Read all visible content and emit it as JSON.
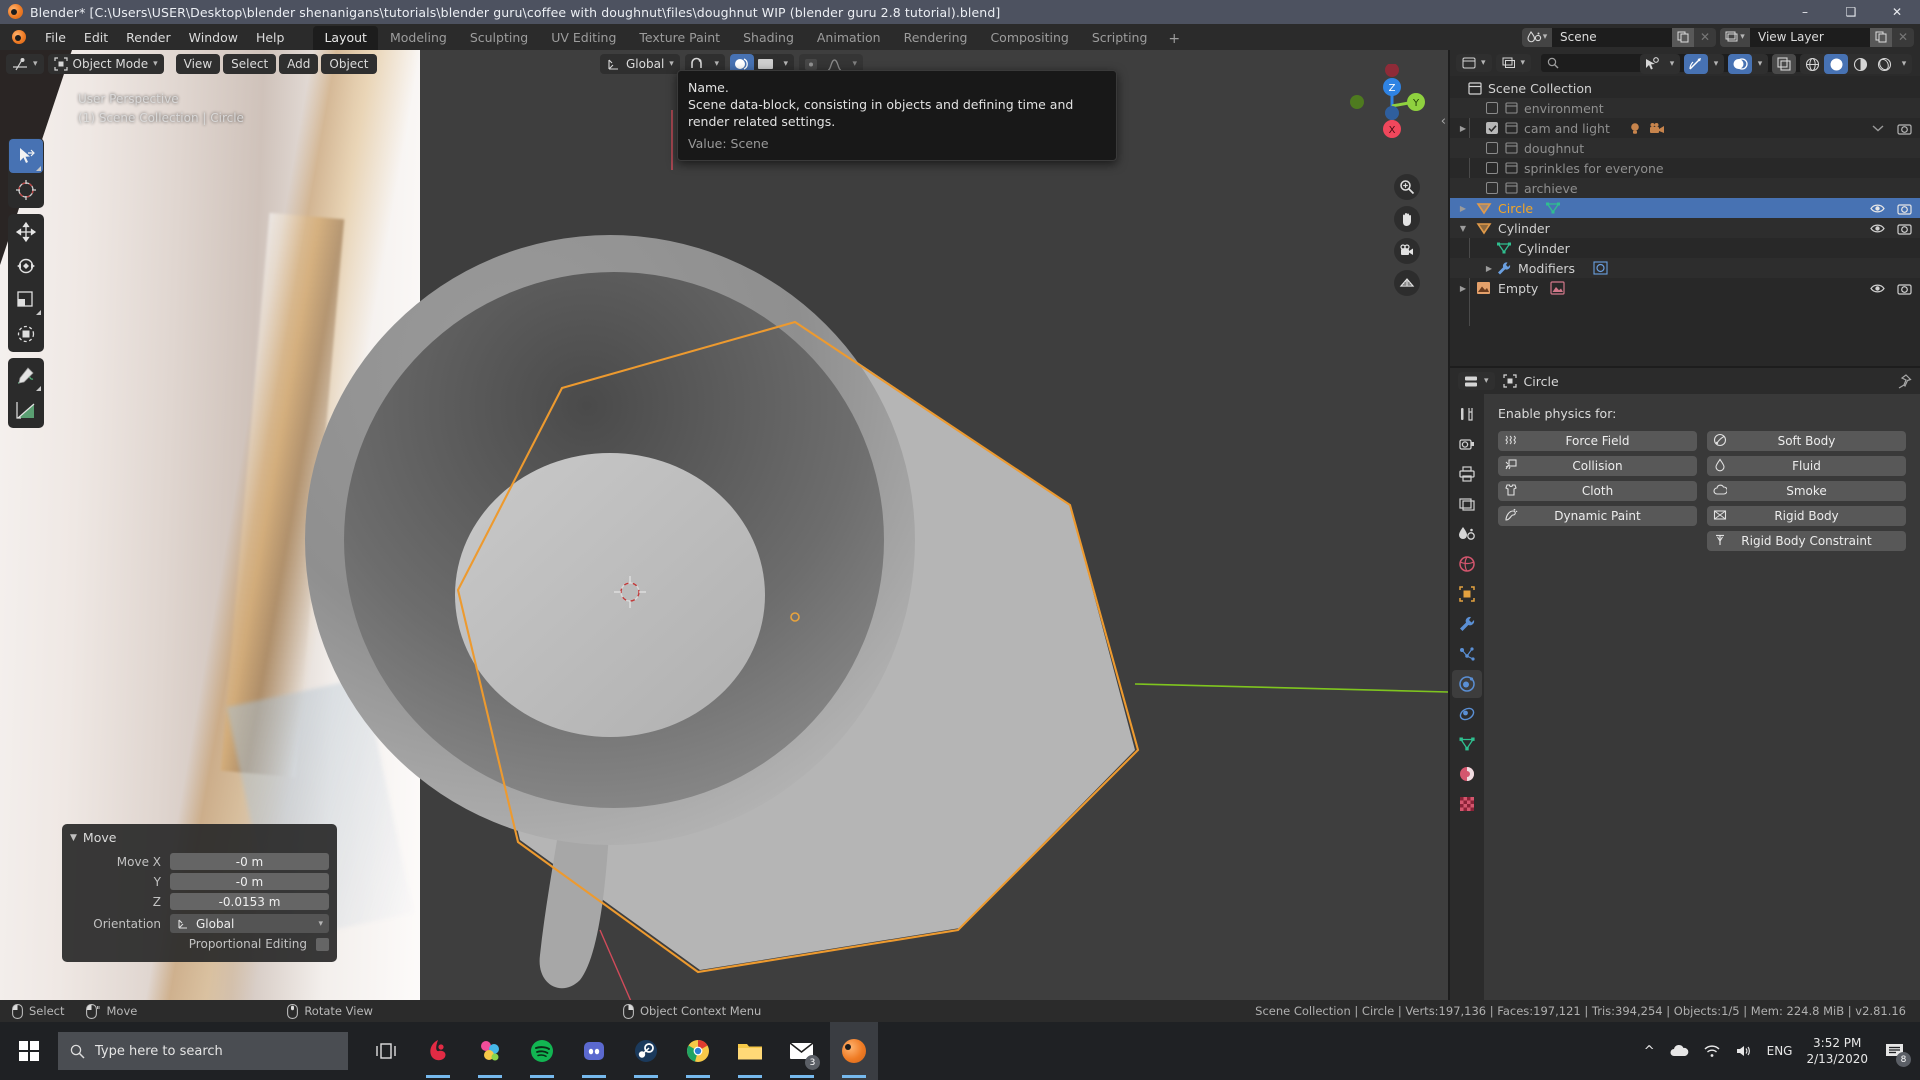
{
  "window": {
    "title": "Blender* [C:\\Users\\USER\\Desktop\\blender shenanigans\\tutorials\\blender guru\\coffee with doughnut\\files\\doughnut WIP (blender guru 2.8 tutorial).blend]",
    "minimize": "–",
    "maximize": "❑",
    "close": "✕"
  },
  "topbar": {
    "menus": [
      "File",
      "Edit",
      "Render",
      "Window",
      "Help"
    ],
    "workspaces": [
      "Layout",
      "Modeling",
      "Sculpting",
      "UV Editing",
      "Texture Paint",
      "Shading",
      "Animation",
      "Rendering",
      "Compositing",
      "Scripting"
    ],
    "active_workspace": "Layout",
    "add_workspace": "+",
    "scene_datablock": "Scene",
    "viewlayer_datablock": "View Layer"
  },
  "viewport": {
    "editor_mode": "Object Mode",
    "menus": [
      "View",
      "Select",
      "Add",
      "Object"
    ],
    "transform_orientation": "Global",
    "overlay_line1": "User Perspective",
    "overlay_line2": "(1) Scene Collection | Circle",
    "gizmo_axes": {
      "x": "X",
      "y": "Y",
      "z": "Z"
    }
  },
  "tooltip": {
    "line1": "Name.",
    "line2": "Scene data-block, consisting in objects and defining time and render related settings.",
    "value": "Value: Scene"
  },
  "operator_panel": {
    "title": "Move",
    "collapse_icon": "▼",
    "rows": [
      {
        "label": "Move X",
        "value": "-0 m"
      },
      {
        "label": "Y",
        "value": "-0 m"
      },
      {
        "label": "Z",
        "value": "-0.0153 m"
      }
    ],
    "orientation_label": "Orientation",
    "orientation_value": "Global",
    "proportional_label": "Proportional Editing"
  },
  "outliner": {
    "root": "Scene Collection",
    "items": [
      {
        "label": "environment",
        "type": "collection",
        "checked": false,
        "dim": true,
        "indent": 1,
        "expandable": false,
        "eye": false,
        "cam": false
      },
      {
        "label": "cam and light",
        "type": "collection",
        "checked": true,
        "dim": true,
        "indent": 1,
        "expandable": true,
        "eye": false,
        "cam": true,
        "extra_icons": [
          "light-icon",
          "camera-icon"
        ],
        "chevron": true
      },
      {
        "label": "doughnut",
        "type": "collection",
        "checked": false,
        "dim": true,
        "indent": 1,
        "expandable": false,
        "eye": false,
        "cam": false
      },
      {
        "label": "sprinkles for everyone",
        "type": "collection",
        "checked": false,
        "dim": true,
        "indent": 1,
        "expandable": false,
        "eye": false,
        "cam": false
      },
      {
        "label": "archieve",
        "type": "collection",
        "checked": false,
        "dim": true,
        "indent": 1,
        "expandable": false,
        "eye": false,
        "cam": false
      },
      {
        "label": "Circle",
        "type": "mesh-object",
        "selected": true,
        "indent": 1,
        "expandable": true,
        "eye": true,
        "cam": true,
        "extra_icons": [
          "mesh-data-icon"
        ]
      },
      {
        "label": "Cylinder",
        "type": "mesh-object",
        "indent": 1,
        "expandable": true,
        "expanded": true,
        "eye": true,
        "cam": true
      },
      {
        "label": "Cylinder",
        "type": "mesh-data",
        "indent": 2,
        "expandable": false,
        "eye": false,
        "cam": false
      },
      {
        "label": "Modifiers",
        "type": "modifier",
        "indent": 2,
        "expandable": true,
        "eye": false,
        "cam": false,
        "extra_icons": [
          "subsurf-icon"
        ]
      },
      {
        "label": "Empty",
        "type": "empty-image",
        "indent": 1,
        "expandable": true,
        "eye": true,
        "cam": true,
        "extra_icons": [
          "image-icon"
        ]
      }
    ]
  },
  "properties": {
    "breadcrumb_object": "Circle",
    "heading": "Enable physics for:",
    "physics_buttons_left": [
      {
        "label": "Force Field",
        "icon": "force-field-icon"
      },
      {
        "label": "Collision",
        "icon": "collision-icon"
      },
      {
        "label": "Cloth",
        "icon": "cloth-icon"
      },
      {
        "label": "Dynamic Paint",
        "icon": "dynamic-paint-icon"
      }
    ],
    "physics_buttons_right": [
      {
        "label": "Soft Body",
        "icon": "soft-body-icon"
      },
      {
        "label": "Fluid",
        "icon": "fluid-icon"
      },
      {
        "label": "Smoke",
        "icon": "smoke-icon"
      },
      {
        "label": "Rigid Body",
        "icon": "rigid-body-icon"
      },
      {
        "label": "Rigid Body Constraint",
        "icon": "rigid-body-constraint-icon"
      }
    ],
    "tabs": [
      "tool-tab",
      "render-tab",
      "output-tab",
      "view-layer-tab",
      "scene-tab",
      "world-tab",
      "object-tab",
      "modifier-tab",
      "particles-tab",
      "physics-tab",
      "constraints-tab",
      "data-tab",
      "material-tab",
      "texture-tab"
    ],
    "active_tab": "physics-tab"
  },
  "statusbar": {
    "keymap": [
      {
        "label": "Select",
        "icon": "mouse-left-icon"
      },
      {
        "label": "Move",
        "icon": "mouse-move-icon"
      },
      {
        "label": "Rotate View",
        "icon": "mouse-middle-icon"
      },
      {
        "label": "Object Context Menu",
        "icon": "mouse-right-icon"
      }
    ],
    "stats": "Scene Collection | Circle | Verts:197,136 | Faces:197,121 | Tris:394,254 | Objects:1/5 | Mem: 224.8 MiB | v2.81.16"
  },
  "taskbar": {
    "search_placeholder": "Type here to search",
    "apps": [
      "task-view-icon",
      "krita-icon",
      "paint3d-icon",
      "spotify-icon",
      "discord-icon",
      "steam-icon",
      "chrome-icon",
      "file-explorer-icon",
      "mail-icon",
      "blender-icon"
    ],
    "mail_badge": "3",
    "tray": {
      "language": "ENG",
      "time": "3:52 PM",
      "date": "2/13/2020",
      "notification_count": "8"
    }
  },
  "colors": {
    "accent_blue": "#4772b3",
    "selected_orange": "#f5a623",
    "axis_x": "#f0475c",
    "axis_y": "#8fd13f",
    "axis_z": "#2f83e3"
  }
}
